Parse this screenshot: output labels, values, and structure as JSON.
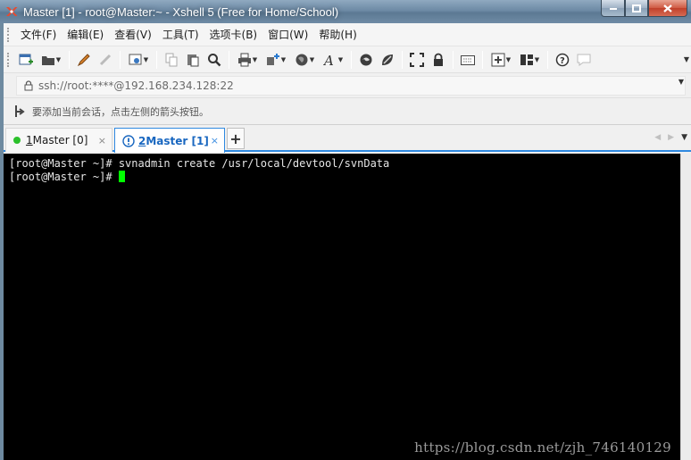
{
  "window": {
    "title": "Master [1] - root@Master:~ - Xshell 5 (Free for Home/School)"
  },
  "menu": [
    {
      "label": "文件(F)"
    },
    {
      "label": "编辑(E)"
    },
    {
      "label": "查看(V)"
    },
    {
      "label": "工具(T)"
    },
    {
      "label": "选项卡(B)"
    },
    {
      "label": "窗口(W)"
    },
    {
      "label": "帮助(H)"
    }
  ],
  "address": {
    "value": "ssh://root:****@192.168.234.128:22"
  },
  "hint": {
    "text": "要添加当前会话，点击左侧的箭头按钮。"
  },
  "tabs": [
    {
      "number": "1",
      "label": " Master [0]",
      "close": "×"
    },
    {
      "number": "2",
      "label": " Master [1]",
      "close": "×"
    }
  ],
  "add_tab": "+",
  "terminal": {
    "lines": [
      "[root@Master ~]# svnadmin create /usr/local/devtool/svnData",
      "[root@Master ~]# "
    ]
  },
  "watermark": "https://blog.csdn.net/zjh_746140129",
  "colors": {
    "accent": "#2f89e0",
    "cursor": "#00ff00",
    "status_dot": "#2bc12b"
  }
}
